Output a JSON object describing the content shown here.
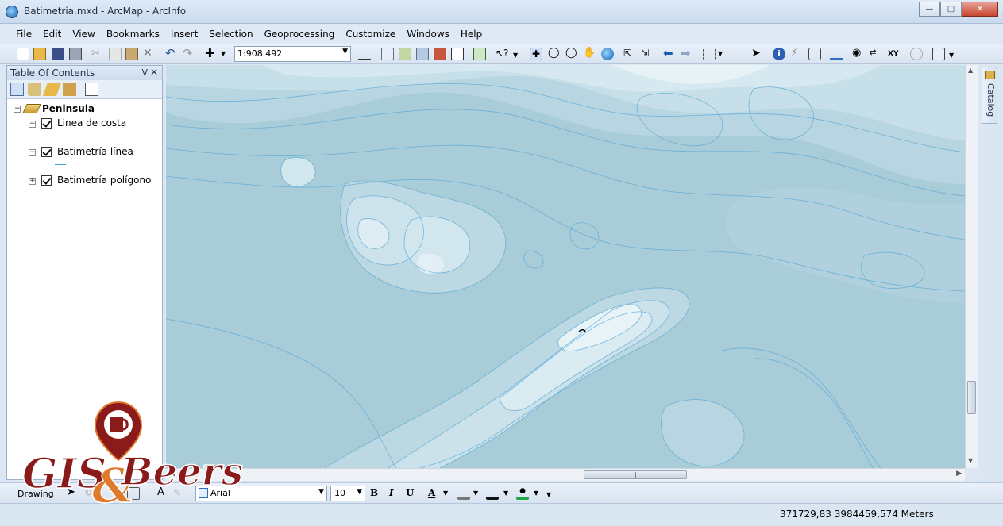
{
  "window": {
    "title": "Batimetria.mxd - ArcMap - ArcInfo",
    "minimize": "0",
    "maximize": "1",
    "close": "r"
  },
  "menu": {
    "items": [
      "File",
      "Edit",
      "View",
      "Bookmarks",
      "Insert",
      "Selection",
      "Geoprocessing",
      "Customize",
      "Windows",
      "Help"
    ]
  },
  "toolbar": {
    "scale": "1:908.492"
  },
  "toc": {
    "title": "Table Of Contents",
    "pin": "ᵖ",
    "close": "✕",
    "group": "Peninsula",
    "layers": [
      {
        "name": "Linea de costa",
        "checked": true,
        "expanded": true
      },
      {
        "name": "Batimetría línea",
        "checked": true,
        "expanded": true
      },
      {
        "name": "Batimetría polígono",
        "checked": true,
        "expanded": false
      }
    ],
    "expanded_sign": "−",
    "collapsed_sign": "+"
  },
  "catalog_tab": {
    "label": "Catalog"
  },
  "drawing_toolbar": {
    "label": "Drawing",
    "font": "Arial",
    "size": "10",
    "bold": "B",
    "italic": "I",
    "underline": "U",
    "font_color": "A"
  },
  "status": {
    "coordinates": "371729,83  3984459,574 Meters"
  },
  "logo": {
    "text_left": "GIS",
    "text_amp": "&",
    "text_right": "Beers"
  },
  "colors": {
    "ocean_deep": "#a8ccd8",
    "ocean_mid": "#bcd8e2",
    "ocean_shallow": "#d8eaf0",
    "contour": "#5aa9d9",
    "logo_red": "#8b1a1a",
    "logo_orange": "#e07a2a"
  }
}
